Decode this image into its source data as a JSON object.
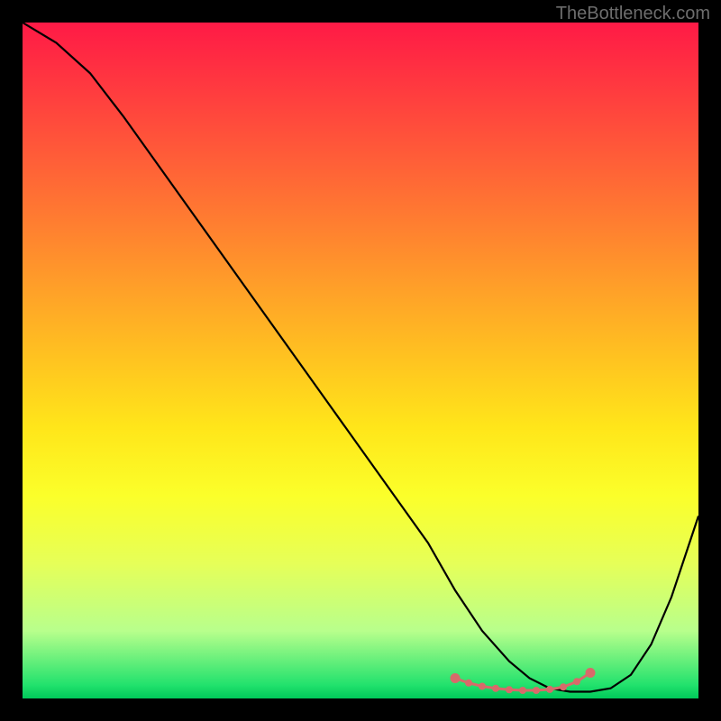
{
  "watermark": "TheBottleneck.com",
  "chart_data": {
    "type": "line",
    "title": "",
    "xlabel": "",
    "ylabel": "",
    "xlim": [
      0,
      100
    ],
    "ylim": [
      0,
      100
    ],
    "series": [
      {
        "name": "curve",
        "x": [
          0,
          5,
          10,
          15,
          20,
          25,
          30,
          35,
          40,
          45,
          50,
          55,
          60,
          64,
          68,
          72,
          75,
          78,
          81,
          84,
          87,
          90,
          93,
          96,
          100
        ],
        "y": [
          100,
          97,
          92.5,
          86,
          79,
          72,
          65,
          58,
          51,
          44,
          37,
          30,
          23,
          16,
          10,
          5.5,
          3,
          1.5,
          1,
          1,
          1.5,
          3.5,
          8,
          15,
          27
        ]
      },
      {
        "name": "highlight-points",
        "x": [
          64,
          66,
          68,
          70,
          72,
          74,
          76,
          78,
          80,
          82,
          84
        ],
        "y": [
          3.0,
          2.3,
          1.8,
          1.5,
          1.3,
          1.2,
          1.2,
          1.35,
          1.7,
          2.5,
          3.8
        ]
      }
    ],
    "colors": {
      "curve": "#000000",
      "highlight": "#d86a6a"
    }
  }
}
